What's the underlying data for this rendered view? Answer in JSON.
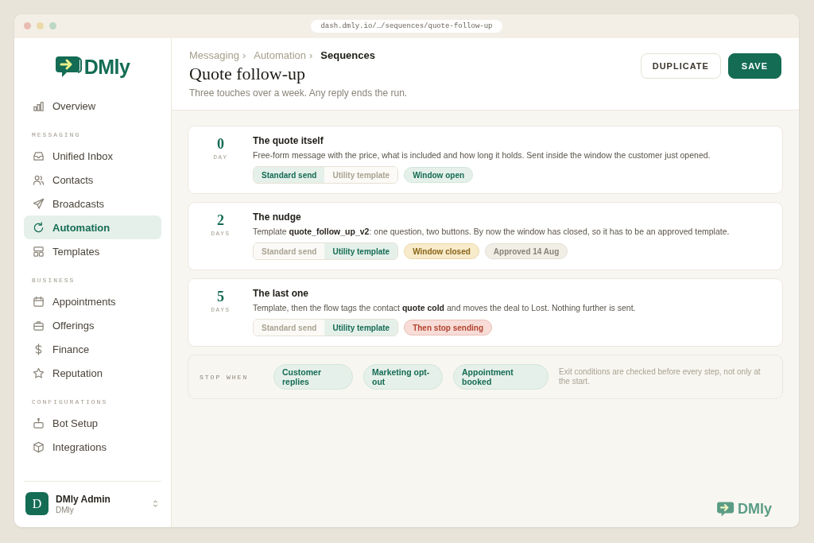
{
  "browser": {
    "url": "dash.dmly.io/…/sequences/quote-follow-up"
  },
  "sidebar": {
    "logo": "DMly",
    "top": [
      {
        "label": "Overview",
        "selected": false
      }
    ],
    "sections": [
      {
        "heading": "MESSAGING",
        "items": [
          {
            "label": "Unified Inbox",
            "selected": false
          },
          {
            "label": "Contacts",
            "selected": false
          },
          {
            "label": "Broadcasts",
            "selected": false
          },
          {
            "label": "Automation",
            "selected": true
          },
          {
            "label": "Templates",
            "selected": false
          }
        ]
      },
      {
        "heading": "BUSINESS",
        "items": [
          {
            "label": "Appointments",
            "selected": false
          },
          {
            "label": "Offerings",
            "selected": false
          },
          {
            "label": "Finance",
            "selected": false
          },
          {
            "label": "Reputation",
            "selected": false
          }
        ]
      },
      {
        "heading": "CONFIGURATIONS",
        "items": [
          {
            "label": "Bot Setup",
            "selected": false
          },
          {
            "label": "Integrations",
            "selected": false
          }
        ]
      }
    ],
    "user": {
      "initial": "D",
      "name": "DMly Admin",
      "org": "DMly"
    }
  },
  "header": {
    "breadcrumbs": [
      "Messaging",
      "Automation",
      "Sequences"
    ],
    "separator": "›",
    "title": "Quote follow-up",
    "subtitle": "Three touches over a week. Any reply ends the run.",
    "buttons": [
      {
        "label": "DUPLICATE",
        "kind": "secondary"
      },
      {
        "label": "SAVE",
        "kind": "primary"
      }
    ]
  },
  "steps": [
    {
      "number": "0",
      "unit": "DAY",
      "title": "The quote itself",
      "description": "Free-form message with the price, what is included and how long it holds. Sent inside the window the customer just opened.",
      "send_modes": [
        {
          "label": "Standard send",
          "selected": true
        },
        {
          "label": "Utility template",
          "selected": false
        }
      ],
      "tags": [
        {
          "label": "Window open",
          "kind": "success"
        }
      ]
    },
    {
      "number": "2",
      "unit": "DAYS",
      "title": "The nudge",
      "description": "Template **quote_follow_up_v2**: one question, two buttons. By now the window has closed, so it has to be an approved template.",
      "send_modes": [
        {
          "label": "Standard send",
          "selected": false
        },
        {
          "label": "Utility template",
          "selected": true
        }
      ],
      "tags": [
        {
          "label": "Window closed",
          "kind": "warning"
        },
        {
          "label": "Approved 14 Aug",
          "kind": "neutral"
        }
      ]
    },
    {
      "number": "5",
      "unit": "DAYS",
      "title": "The last one",
      "description": "Template, then the flow tags the contact **quote cold** and moves the deal to Lost. Nothing further is sent.",
      "send_modes": [
        {
          "label": "Standard send",
          "selected": false
        },
        {
          "label": "Utility template",
          "selected": true
        }
      ],
      "tags": [
        {
          "label": "Then stop sending",
          "kind": "danger"
        }
      ]
    }
  ],
  "stop": {
    "label": "STOP WHEN",
    "conditions": [
      "Customer replies",
      "Marketing opt-out",
      "Appointment booked"
    ],
    "note": "Exit conditions are checked before every step, not only at the start."
  },
  "footer": {
    "logo": "DMly"
  }
}
